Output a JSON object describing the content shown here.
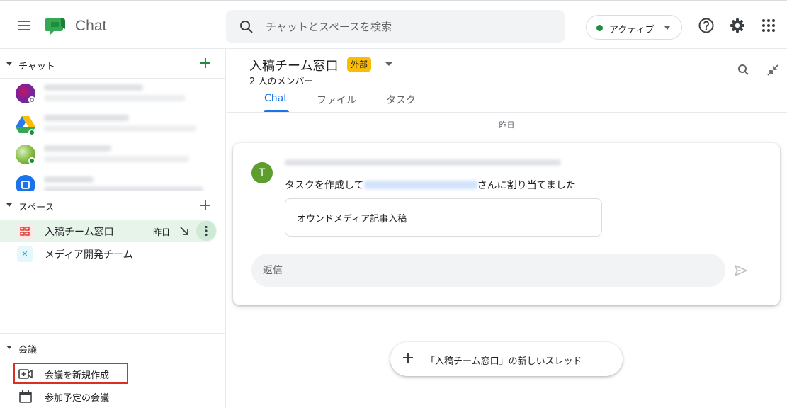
{
  "header": {
    "app_name": "Chat",
    "search_placeholder": "チャットとスペースを検索",
    "status_label": "アクティブ",
    "status_color": "#1e8e3e",
    "icons": [
      "menu-icon",
      "chat-logo",
      "search-icon",
      "help-icon",
      "gear-icon",
      "apps-grid-icon"
    ]
  },
  "sidebar": {
    "chat_section": {
      "title": "チャット",
      "items": [
        {
          "avatar": "photo-avatar",
          "presence": "offline"
        },
        {
          "avatar": "google-drive-icon",
          "presence": "online"
        },
        {
          "avatar": "photo-avatar",
          "presence": "online"
        },
        {
          "avatar": "calendar-avatar",
          "presence": "none"
        }
      ]
    },
    "spaces_section": {
      "title": "スペース",
      "items": [
        {
          "name": "入稿チーム窓口",
          "time": "昨日",
          "selected": true
        },
        {
          "name": "メディア開発チーム",
          "selected": false
        }
      ]
    },
    "meetings_section": {
      "title": "会議",
      "items": [
        {
          "label": "会議を新規作成",
          "icon": "video-add-icon"
        },
        {
          "label": "参加予定の会議",
          "icon": "calendar-icon"
        }
      ]
    }
  },
  "main": {
    "room_title": "入稿チーム窓口",
    "external_badge": "外部",
    "members": "2 人のメンバー",
    "tabs": [
      {
        "label": "Chat",
        "active": true
      },
      {
        "label": "ファイル",
        "active": false
      },
      {
        "label": "タスク",
        "active": false
      }
    ],
    "date_separator": "昨日",
    "message": {
      "avatar_letter": "T",
      "text_before": "タスクを作成して",
      "text_after": "さんに割り当てました",
      "task_title": "オウンドメディア記事入稿"
    },
    "reply_placeholder": "返信",
    "new_thread_label": "「入稿チーム窓口」の新しいスレッド"
  }
}
